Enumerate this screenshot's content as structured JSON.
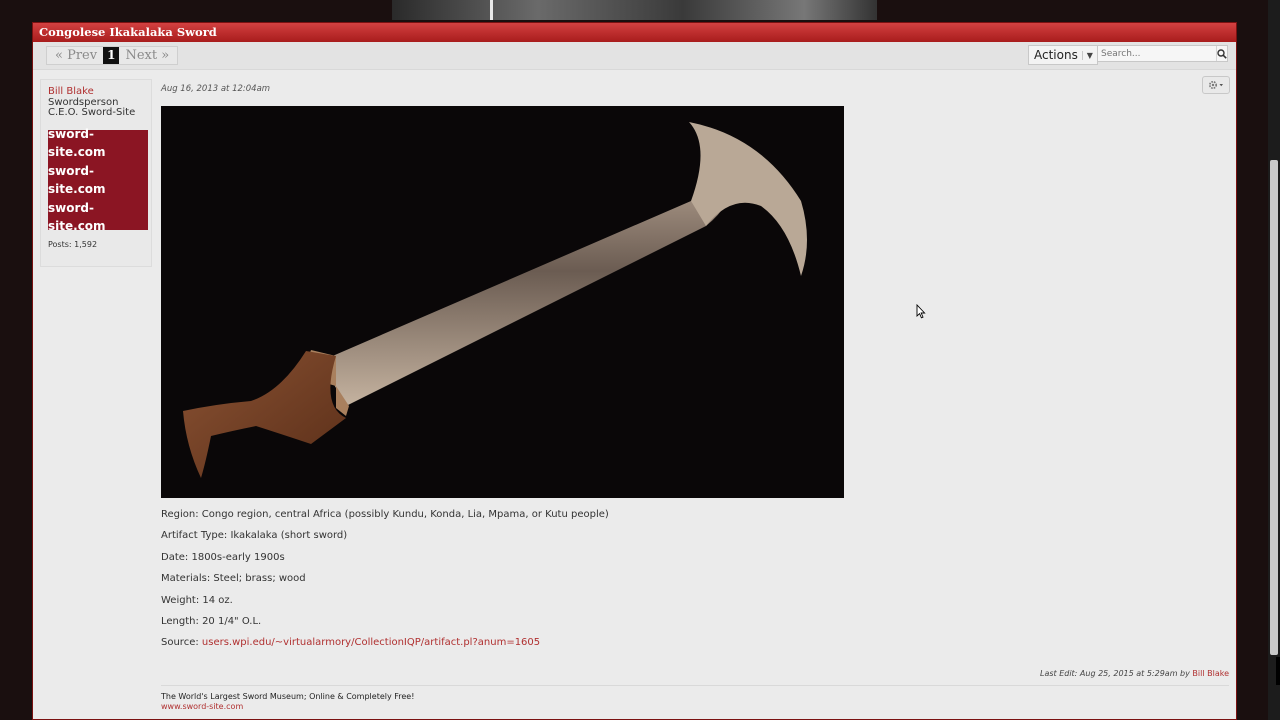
{
  "thread": {
    "title": "Congolese Ikakalaka Sword",
    "pager": {
      "prev": "« Prev",
      "current": "1",
      "next": "Next »"
    },
    "actions_label": "Actions",
    "search_placeholder": "Search..."
  },
  "author": {
    "name": "Bill Blake",
    "rank": "Swordsperson",
    "title": "C.E.O. Sword-Site",
    "avatar_lines": [
      "sword-site.com",
      "sword-site.com",
      "sword-site.com"
    ],
    "posts": "Posts: 1,592"
  },
  "post": {
    "date": "Aug 16, 2013 at 12:04am",
    "fields": [
      {
        "label": "Region:",
        "value": "Congo region, central Africa (possibly Kundu, Konda, Lia, Mpama, or Kutu people)"
      },
      {
        "label": "Artifact Type:",
        "value": "Ikakalaka (short sword)"
      },
      {
        "label": "Date:",
        "value": "1800s-early 1900s"
      },
      {
        "label": "Materials:",
        "value": "Steel; brass; wood"
      },
      {
        "label": "Weight:",
        "value": "14 oz."
      },
      {
        "label": "Length:",
        "value": "20 1/4\" O.L."
      }
    ],
    "source_label": "Source:",
    "source_link": "users.wpi.edu/~virtualarmory/CollectionIQP/artifact.pl?anum=1605",
    "last_edit": "Last Edit: Aug 25, 2015 at 5:29am",
    "last_edit_by": "by",
    "last_edit_user": "Bill Blake",
    "signature_line": "The World's Largest Sword Museum; Online & Completely Free!",
    "signature_link": "www.sword-site.com"
  },
  "colors": {
    "title_bar": "#c62e2e",
    "link": "#b03030",
    "avatar_bg": "#8b1523",
    "page_bg": "#ebebeb"
  },
  "icons": {
    "search": "magnifier-icon",
    "gear": "gear-icon",
    "caret": "caret-down-icon"
  }
}
